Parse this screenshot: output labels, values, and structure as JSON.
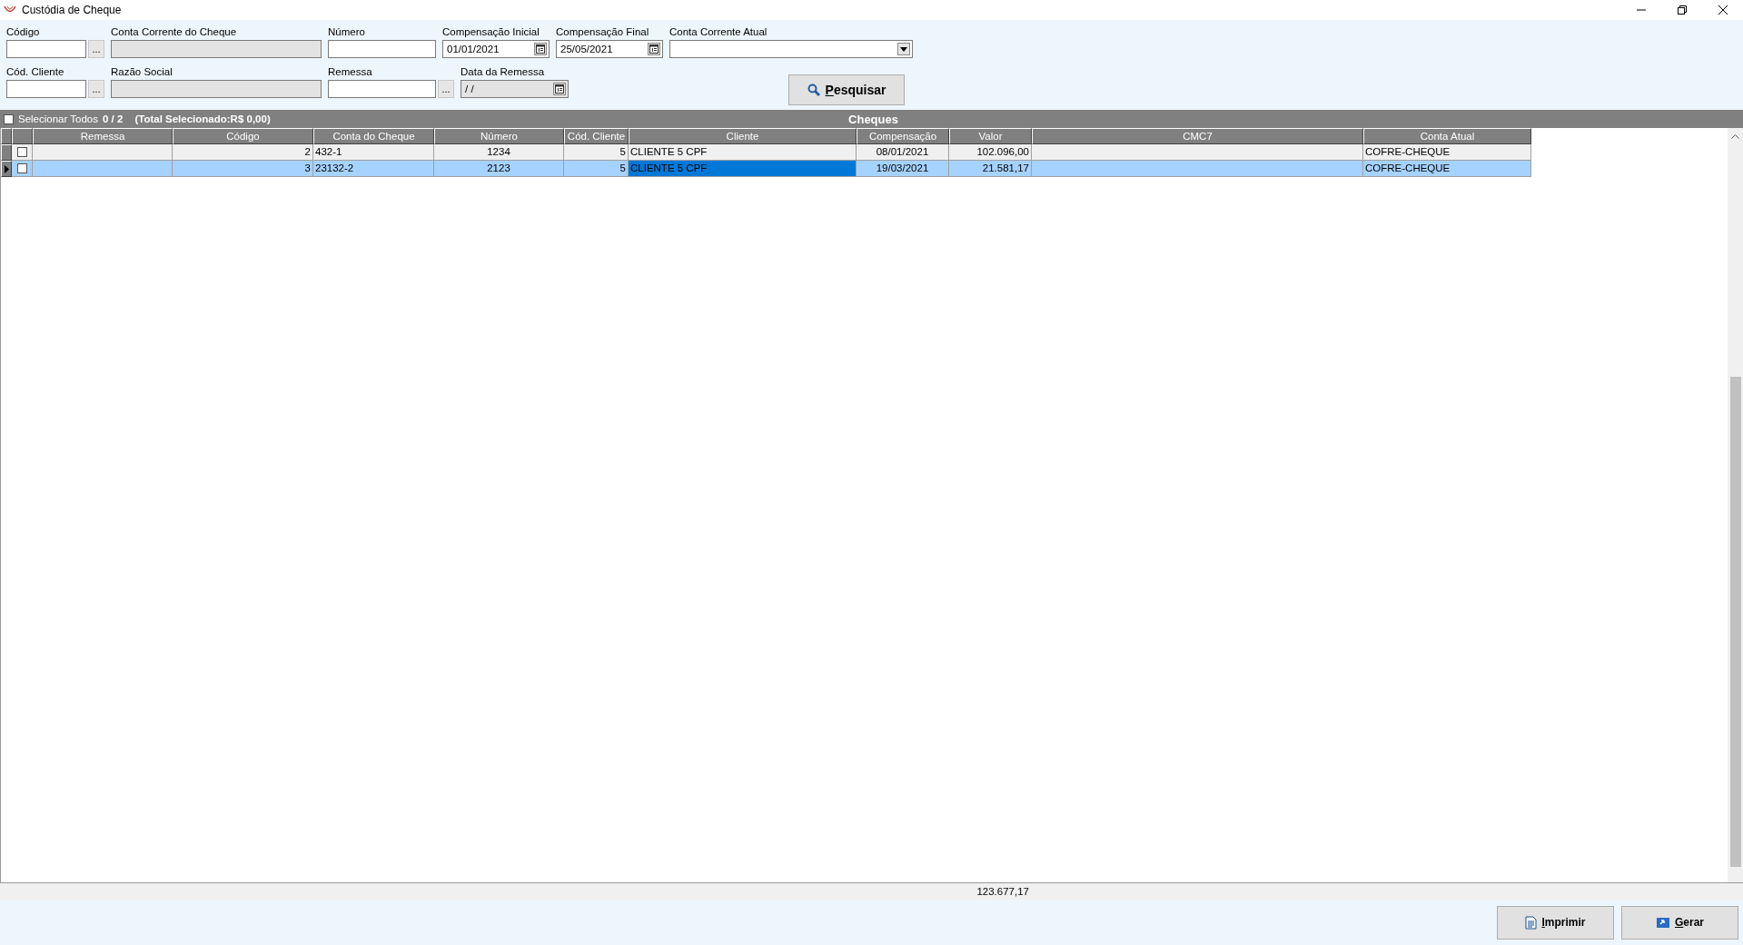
{
  "window": {
    "title": "Custódia de Cheque"
  },
  "filter_rows": [
    {
      "fields": [
        {
          "kind": "text",
          "label": "Código",
          "lookup_label": "..."
        },
        {
          "kind": "readonly",
          "label": "Conta Corrente do Cheque"
        },
        {
          "kind": "text",
          "label": "Número"
        },
        {
          "kind": "date",
          "label": "Compensação Inicial",
          "value": "01/01/2021",
          "disabled": false
        },
        {
          "kind": "date",
          "label": "Compensação Final",
          "value": "25/05/2021",
          "disabled": false
        },
        {
          "kind": "combo",
          "label": "Conta Corrente Atual"
        }
      ]
    },
    {
      "fields": [
        {
          "kind": "text",
          "label": "Cód. Cliente",
          "lookup_label": "..."
        },
        {
          "kind": "readonly",
          "label": "Razão Social"
        },
        {
          "kind": "text",
          "label": "Remessa",
          "lookup_label": "..."
        },
        {
          "kind": "date",
          "label": "Data da Remessa",
          "value": "/ /",
          "disabled": true
        }
      ]
    }
  ],
  "search_button": {
    "accel": "P",
    "rest": "esquisar"
  },
  "grid": {
    "select_all": {
      "label": "Selecionar Todos",
      "checked": false
    },
    "count": "0 / 2",
    "total_selected": "(Total Selecionado:R$ 0,00)",
    "title": "Cheques",
    "columns": [
      "Remessa",
      "Código",
      "Conta do Cheque",
      "Número",
      "Cód. Cliente",
      "Cliente",
      "Compensação",
      "Valor",
      "CMC7",
      "Conta Atual"
    ],
    "rows": [
      {
        "checked": false,
        "selected": false,
        "cells": [
          {
            "text": null,
            "focused": false
          },
          {
            "text": "2",
            "focused": false
          },
          {
            "text": "432-1",
            "focused": false
          },
          {
            "text": "1234",
            "focused": false
          },
          {
            "text": "5",
            "focused": false
          },
          {
            "text": "CLIENTE 5 CPF",
            "focused": false
          },
          {
            "text": "08/01/2021",
            "focused": false
          },
          {
            "text": "102.096,00",
            "focused": false
          },
          {
            "text": null,
            "focused": false
          },
          {
            "text": "COFRE-CHEQUE",
            "focused": false
          }
        ]
      },
      {
        "checked": false,
        "selected": true,
        "cells": [
          {
            "text": null,
            "focused": false
          },
          {
            "text": "3",
            "focused": false
          },
          {
            "text": "23132-2",
            "focused": false
          },
          {
            "text": "2123",
            "focused": false
          },
          {
            "text": "5",
            "focused": false
          },
          {
            "text": "CLIENTE 5 CPF",
            "focused": true
          },
          {
            "text": "19/03/2021",
            "focused": false
          },
          {
            "text": "21.581,17",
            "focused": false
          },
          {
            "text": null,
            "focused": false
          },
          {
            "text": "COFRE-CHEQUE",
            "focused": false
          }
        ]
      }
    ],
    "total": "123.677,17"
  },
  "buttons": [
    {
      "kind": "print",
      "accel": "I",
      "rest": "mprimir"
    },
    {
      "kind": "generate",
      "accel": "G",
      "rest": "erar"
    }
  ]
}
